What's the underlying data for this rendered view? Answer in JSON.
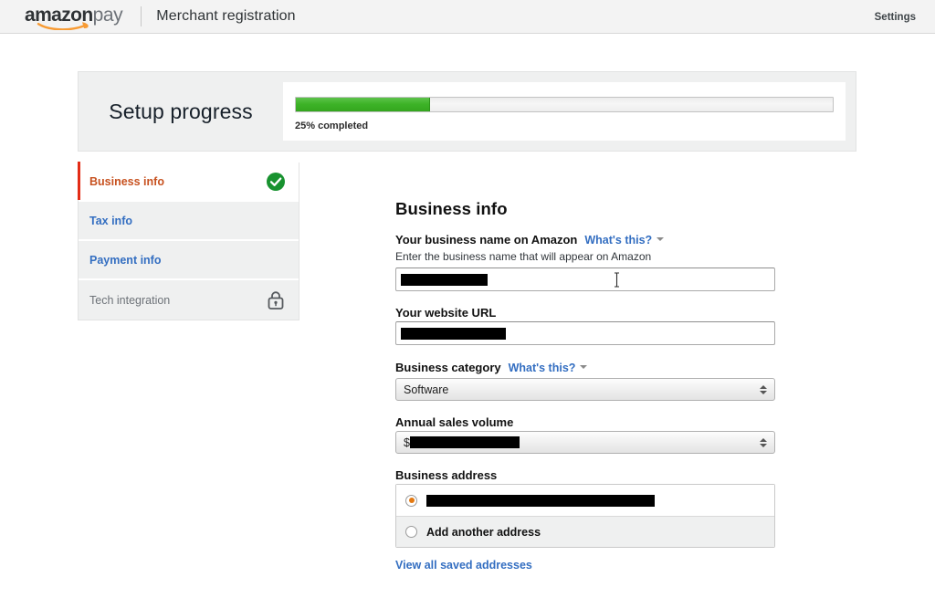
{
  "header": {
    "logo_amazon": "amazon",
    "logo_pay": "pay",
    "title": "Merchant registration",
    "settings_label": "Settings",
    "logo_swoosh_icon": "amazon-swoosh-arrow-icon",
    "accent_orange": "#f79b34"
  },
  "progress": {
    "title": "Setup progress",
    "percent": 25,
    "label": "25% completed",
    "fill_color": "#3db327",
    "track_color": "#efefef"
  },
  "sidebar": {
    "items": [
      {
        "label": "Business info",
        "state": "active",
        "icon": "check-circle-icon"
      },
      {
        "label": "Tax info",
        "state": "link",
        "icon": ""
      },
      {
        "label": "Payment info",
        "state": "link",
        "icon": ""
      },
      {
        "label": "Tech integration",
        "state": "locked",
        "icon": "lock-icon"
      }
    ],
    "active_color": "#c7511f",
    "link_color": "#336ec1",
    "check_color": "#18922f"
  },
  "form": {
    "heading": "Business info",
    "business_name": {
      "label": "Your business name on Amazon",
      "whats_this": "What's this?",
      "hint": "Enter the business name that will appear on Amazon",
      "value": "",
      "redacted": true,
      "redact_width": 95
    },
    "website_url": {
      "label": "Your website URL",
      "value": "",
      "redacted": true,
      "redact_width": 115
    },
    "business_category": {
      "label": "Business category",
      "whats_this": "What's this?",
      "value": "Software"
    },
    "annual_sales_volume": {
      "label": "Annual sales volume",
      "prefix": "$",
      "value": "",
      "redacted": true,
      "redact_width": 120
    },
    "business_address": {
      "label": "Business address",
      "selected_address": "",
      "selected_redacted": true,
      "selected_redact_width": 250,
      "add_another_label": "Add another address",
      "view_all_label": "View all saved addresses"
    }
  }
}
